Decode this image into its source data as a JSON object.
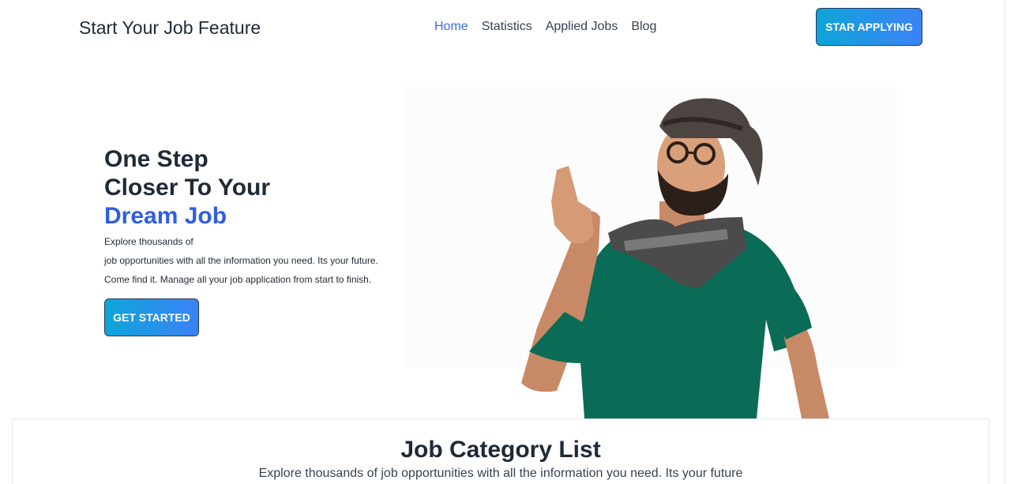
{
  "header": {
    "brand": "Start Your Job Feature",
    "nav": [
      "Home",
      "Statistics",
      "Applied Jobs",
      "Blog"
    ],
    "active_nav": "Home",
    "cta_label": "STAR APPLYING"
  },
  "hero": {
    "title_line1": "One Step",
    "title_line2": "Closer To Your",
    "title_accent": "Dream Job",
    "desc_line1": "Explore thousands of",
    "desc_line2": "job opportunities with all the information you need. Its your future.",
    "desc_line3": "Come find it. Manage all your job application from start to finish.",
    "button_label": "GET STARTED"
  },
  "category": {
    "title": "Job Category List",
    "subtitle": "Explore thousands of job opportunities with all the information you need. Its your future"
  },
  "colors": {
    "accent": "#2f5fe0",
    "nav_active": "#3b6fd6",
    "button_gradient_start": "#0ea5d8",
    "button_gradient_end": "#3b82f6"
  }
}
